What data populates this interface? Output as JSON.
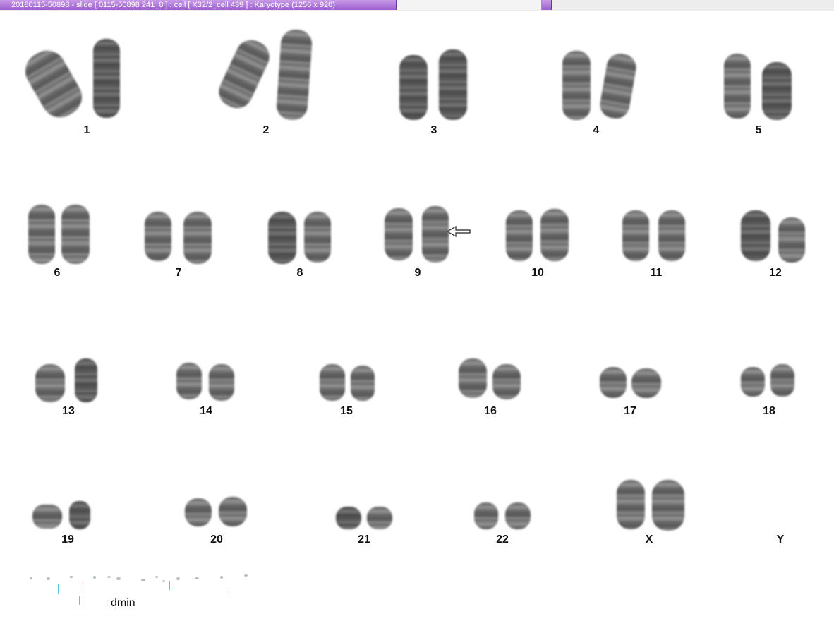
{
  "window": {
    "title": "20180115-50898 - slide [ 0115-50898 241_8 ] : cell [ X32/2_cell 439 ] : Karyotype  (1256 x 920)"
  },
  "karyotype": {
    "chromosomes": [
      {
        "label": "1"
      },
      {
        "label": "2"
      },
      {
        "label": "3"
      },
      {
        "label": "4"
      },
      {
        "label": "5"
      },
      {
        "label": "6"
      },
      {
        "label": "7"
      },
      {
        "label": "8"
      },
      {
        "label": "9"
      },
      {
        "label": "10"
      },
      {
        "label": "11"
      },
      {
        "label": "12"
      },
      {
        "label": "13"
      },
      {
        "label": "14"
      },
      {
        "label": "15"
      },
      {
        "label": "16"
      },
      {
        "label": "17"
      },
      {
        "label": "18"
      },
      {
        "label": "19"
      },
      {
        "label": "20"
      },
      {
        "label": "21"
      },
      {
        "label": "22"
      },
      {
        "label": "X"
      },
      {
        "label": "Y"
      }
    ],
    "dmin_label": "dmin",
    "arrow_marker": "arrow-left-icon"
  }
}
